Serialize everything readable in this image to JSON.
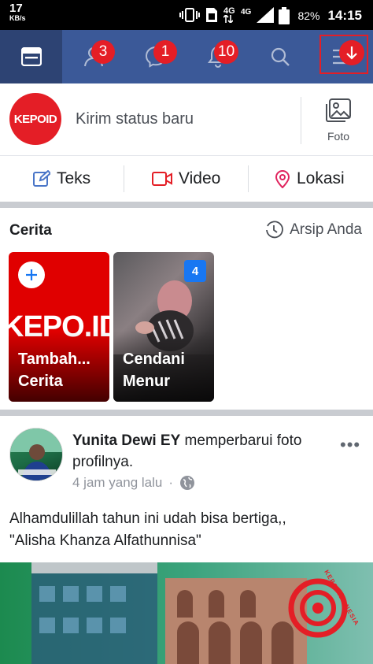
{
  "status_bar": {
    "speed_value": "17",
    "speed_unit": "KB/s",
    "network_label": "4G",
    "battery_percent": "82%",
    "time": "14:15"
  },
  "nav": {
    "badges": {
      "friends": "3",
      "messages": "1",
      "notifications": "10"
    },
    "accent": "#3b5998",
    "badge_color": "#e41e26"
  },
  "composer": {
    "logo_text": "KEPOID",
    "placeholder": "Kirim status baru",
    "photo_label": "Foto"
  },
  "post_types": [
    {
      "label": "Teks",
      "icon": "edit-icon"
    },
    {
      "label": "Video",
      "icon": "video-icon"
    },
    {
      "label": "Lokasi",
      "icon": "location-pin-icon"
    }
  ],
  "stories": {
    "title": "Cerita",
    "archive_label": "Arsip Anda",
    "items": [
      {
        "label_line1": "Tambah...",
        "label_line2": "Cerita",
        "bg_text": "KEPO.ID"
      },
      {
        "label_line1": "Cendani",
        "label_line2": "Menur",
        "count": "4"
      }
    ]
  },
  "post": {
    "author": "Yunita Dewi EY",
    "action": " memperbarui foto profilnya.",
    "time": "4 jam yang lalu",
    "more": "•••",
    "text_line1": "Alhamdulillah tahun ini udah bisa bertiga,,",
    "text_line2": "\"Alisha Khanza Alfathunnisa\"",
    "watermark": "KEPOINDONESIA"
  }
}
